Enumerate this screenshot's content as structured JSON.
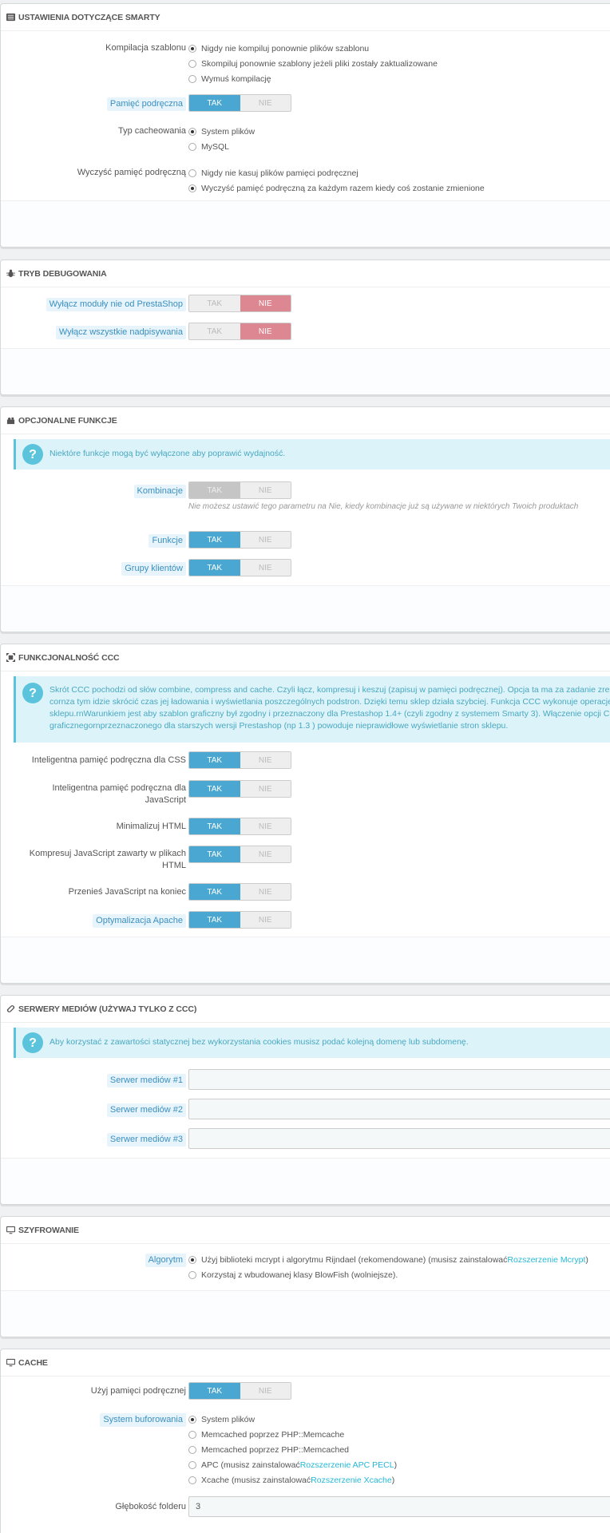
{
  "smarty": {
    "title": "USTAWIENIA DOTYCZĄCE SMARTY",
    "compile_label": "Kompilacja szablonu",
    "compile_options": [
      "Nigdy nie kompiluj ponownie plików szablonu",
      "Skompiluj ponownie szablony jeżeli pliki zostały zaktualizowane",
      "Wymuś kompilację"
    ],
    "cache_label": "Pamięć podręczna",
    "cache_type_label": "Typ cacheowania",
    "cache_type_options": [
      "System plików",
      "MySQL"
    ],
    "clear_label": "Wyczyść pamięć podręczną",
    "clear_options": [
      "Nigdy nie kasuj plików pamięci podręcznej",
      "Wyczyść pamięć podręczną za każdym razem kiedy coś zostanie zmienione"
    ]
  },
  "switch": {
    "yes": "TAK",
    "no": "NIE"
  },
  "debug": {
    "title": "TRYB DEBUGOWANIA",
    "disable_modules_label": "Wyłącz moduły nie od PrestaShop",
    "disable_overrides_label": "Wyłącz wszystkie nadpisywania"
  },
  "optional": {
    "title": "OPCJONALNE FUNKCJE",
    "alert": "Niektóre funkcje mogą być wyłączone aby poprawić wydajność.",
    "combinations_label": "Kombinacje",
    "combinations_help": "Nie możesz ustawić tego parametru na Nie, kiedy kombinacje już są używane w niektórych Twoich produktach",
    "features_label": "Funkcje",
    "groups_label": "Grupy klientów"
  },
  "ccc": {
    "title": "FUNKCJONALNOŚĆ CCC",
    "alert_lines": [
      "Skrót CCC pochodzi od słów combine, compress and cache. Czyli łącz, kompresuj i keszuj (zapisuj w pamięci podręcznej). Opcja ta ma za zadanie zredukować ",
      "cornza tym idzie skrócić czas jej ładowania i wyświetlania poszczególnych podstron. Dzięki temu sklep działa szybciej. Funkcja CCC wykonuje operacje na plika",
      "sklepu.rnWarunkiem jest aby szablon graficzny był zgodny i przeznaczony dla Prestashop 1.4+ (czyli zgodny z systemem Smarty 3). Włączenie opcji CCC dla sza",
      "graficznegornprzeznaczonego dla starszych wersji Prestashop (np 1.3 ) powoduje nieprawidłowe wyświetlanie stron sklepu."
    ],
    "css_label": "Inteligentna pamięć podręczna dla CSS",
    "js_label_1": "Inteligentna pamięć podręczna dla",
    "js_label_2": "JavaScript",
    "html_label": "Minimalizuj HTML",
    "inline_js_label_1": "Kompresuj JavaScript zawarty w plikach",
    "inline_js_label_2": "HTML",
    "move_js_label": "Przenieś JavaScript na koniec",
    "apache_label": "Optymalizacja Apache"
  },
  "media": {
    "title": "SERWERY MEDIÓW (UŻYWAJ TYLKO Z CCC)",
    "alert": "Aby korzystać z zawartości statycznej bez wykorzystania cookies musisz podać kolejną domenę lub subdomenę.",
    "server1_label": "Serwer mediów #1",
    "server2_label": "Serwer mediów #2",
    "server3_label": "Serwer mediów #3",
    "server1_value": "",
    "server2_value": "",
    "server3_value": ""
  },
  "cipher": {
    "title": "SZYFROWANIE",
    "algorithm_label": "Algorytm",
    "option1_text": "Użyj biblioteki mcrypt i algorytmu Rijndael (rekomendowane) (musisz zainstalować ",
    "option1_link": "Rozszerzenie Mcrypt",
    "option1_end": ")",
    "option2_text": "Korzystaj z wbudowanej klasy BlowFish (wolniejsze)."
  },
  "cache": {
    "title": "CACHE",
    "use_label": "Użyj pamięci podręcznej",
    "system_label": "System buforowania",
    "opt_files": "System plików",
    "opt_memcache": "Memcached poprzez PHP::Memcache",
    "opt_memcached": "Memcached poprzez PHP::Memcached",
    "opt_apc_text": "APC (musisz zainstalować ",
    "opt_apc_link": "Rozszerzenie APC PECL",
    "opt_xcache_text": "Xcache (musisz zainstalować ",
    "opt_xcache_link": "Rozszerzenie Xcache",
    "close_paren": ")",
    "depth_label": "Głębokość folderu",
    "depth_value": "3"
  },
  "icons": {
    "smarty": "list-icon",
    "debug": "bug-icon",
    "optional": "puzzle-icon",
    "ccc": "expand-icon",
    "media": "link-icon",
    "cipher": "monitor-icon",
    "cache": "monitor-icon",
    "alert": "question-icon"
  },
  "colors": {
    "accent": "#4aa7d1",
    "danger": "#dd8792",
    "alert_bg": "#dcf4f9",
    "link": "#25b9d7"
  }
}
